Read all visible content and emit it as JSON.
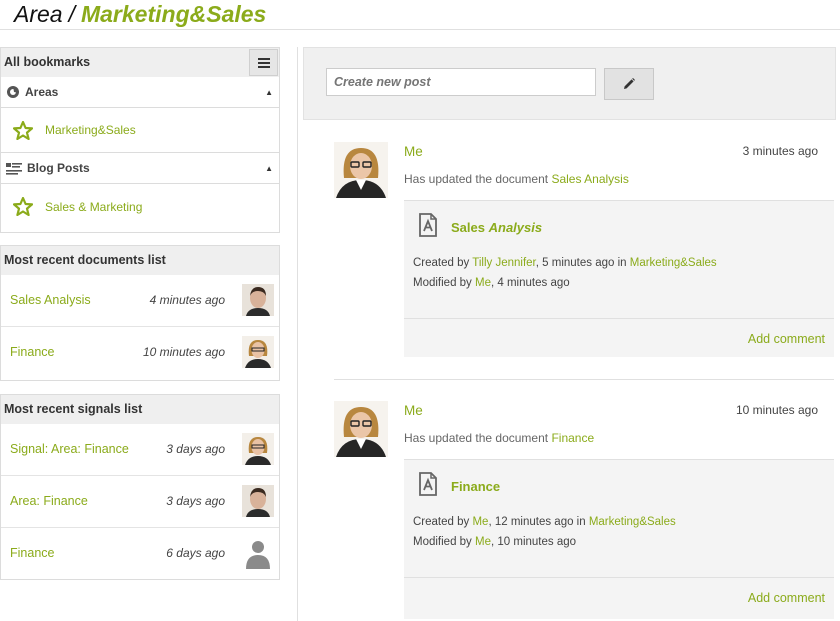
{
  "header": {
    "area_label": "Area",
    "separator": "/",
    "area_name": "Marketing&Sales"
  },
  "sidebar": {
    "bookmarks": {
      "title": "All bookmarks",
      "sections": [
        {
          "label": "Areas",
          "item": "Marketing&Sales"
        },
        {
          "label": "Blog Posts",
          "item": "Sales & Marketing"
        }
      ]
    },
    "documents": {
      "title": "Most recent documents list",
      "rows": [
        {
          "title": "Sales Analysis",
          "time": "4 minutes ago",
          "avatar": "man-avatar"
        },
        {
          "title": "Finance",
          "time": "10 minutes ago",
          "avatar": "woman-avatar"
        }
      ]
    },
    "signals": {
      "title": "Most recent signals list",
      "rows": [
        {
          "title": "Signal: Area: Finance",
          "time": "3 days ago",
          "avatar": "woman-avatar"
        },
        {
          "title": "Area: Finance",
          "time": "3 days ago",
          "avatar": "man-avatar"
        },
        {
          "title": "Finance",
          "time": "6 days ago",
          "avatar": "default-user-icon"
        }
      ]
    }
  },
  "composer": {
    "placeholder": "Create new post"
  },
  "activities": [
    {
      "user": "Me",
      "time": "3 minutes ago",
      "action": "Has updated the document",
      "doc": "Sales Analysis",
      "doc_title_a": "Sales",
      "doc_title_b": "Analysis",
      "created_prefix": "Created by",
      "created_by": "Tilly Jennifer",
      "created_when": ", 5 minutes ago in",
      "created_area": "Marketing&Sales",
      "modified_prefix": "Modified by",
      "modified_by": "Me",
      "modified_when": ", 4 minutes ago",
      "add_comment": "Add comment"
    },
    {
      "user": "Me",
      "time": "10 minutes ago",
      "action": "Has updated the document",
      "doc": "Finance",
      "doc_title_a": "Finance",
      "doc_title_b": "",
      "created_prefix": "Created by",
      "created_by": "Me",
      "created_when": ", 12 minutes ago in",
      "created_area": "Marketing&Sales",
      "modified_prefix": "Modified by",
      "modified_by": "Me",
      "modified_when": ", 10 minutes ago",
      "add_comment": "Add comment"
    }
  ],
  "colors": {
    "accent": "#8bab1b",
    "panel_header": "#efefef",
    "card_bg": "#f4f4f4"
  }
}
